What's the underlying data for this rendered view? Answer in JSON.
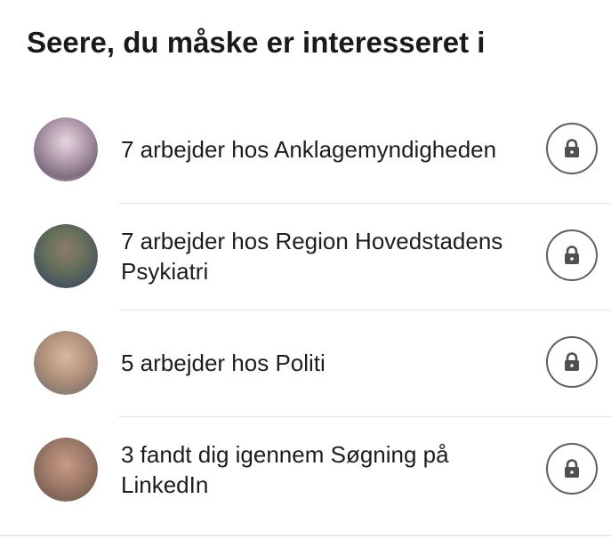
{
  "section": {
    "title": "Seere, du måske er interesseret i"
  },
  "viewers": [
    {
      "text": "7 arbejder hos Anklagemyndigheden",
      "avatar_colors": [
        "#c9b9c6",
        "#8d7a8e",
        "#e8dde4"
      ]
    },
    {
      "text": "7 arbejder hos Region Hovedstadens Psykiatri",
      "avatar_colors": [
        "#6f7a5c",
        "#4c5a63",
        "#8a7a62"
      ]
    },
    {
      "text": "5 arbejder hos Politi",
      "avatar_colors": [
        "#c9a690",
        "#9d8474",
        "#dcc7b7"
      ]
    },
    {
      "text": "3 fandt dig igennem Søgning på LinkedIn",
      "avatar_colors": [
        "#b08a78",
        "#8f6e60",
        "#cfb3a3"
      ]
    }
  ],
  "icons": {
    "lock": "lock-icon"
  }
}
